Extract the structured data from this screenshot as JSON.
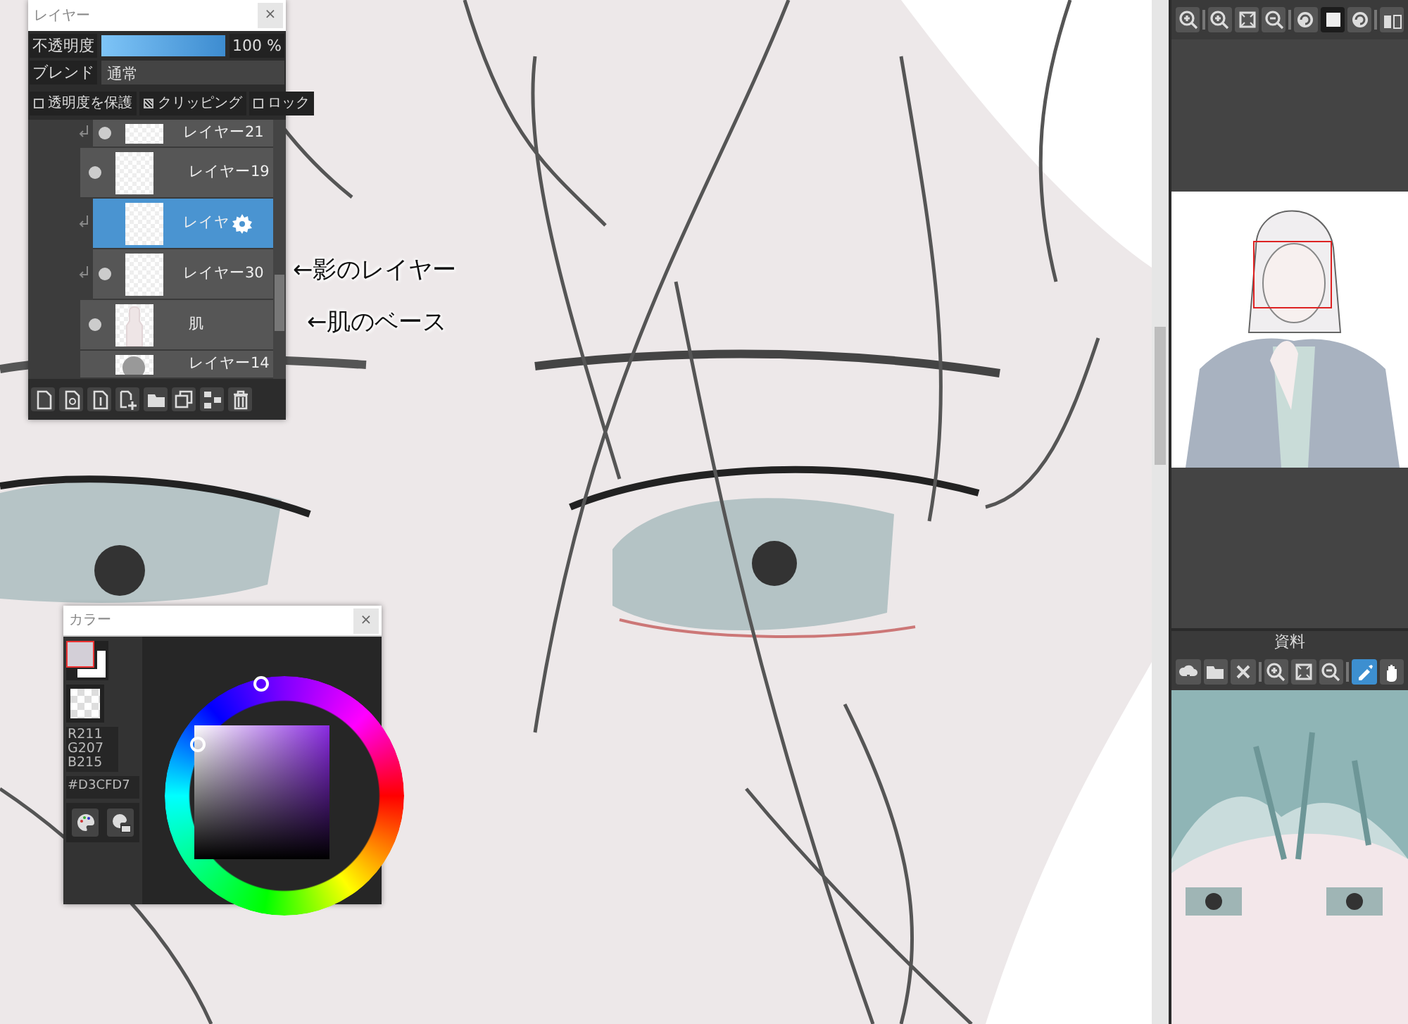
{
  "layer_panel": {
    "title": "レイヤー",
    "close": "×",
    "opacity": {
      "label": "不透明度",
      "level": 1,
      "reading": "100 %"
    },
    "blend": {
      "label": "ブレンド",
      "value": "通常"
    },
    "options": [
      {
        "label": "透明度を保護",
        "checked": false
      },
      {
        "label": "クリッピング",
        "checked": true
      },
      {
        "label": "ロック",
        "checked": false
      }
    ],
    "layers": [
      {
        "name": "レイヤー21",
        "visible": true,
        "clipped": true,
        "selected": false,
        "kind": "blank"
      },
      {
        "name": "レイヤー19",
        "visible": true,
        "clipped": false,
        "selected": false,
        "kind": "blank"
      },
      {
        "name": "レイヤ",
        "visible": false,
        "clipped": true,
        "selected": true,
        "kind": "blank"
      },
      {
        "name": "レイヤー30",
        "visible": true,
        "clipped": true,
        "selected": false,
        "kind": "blank"
      },
      {
        "name": "肌",
        "visible": true,
        "clipped": false,
        "selected": false,
        "kind": "silhouette"
      },
      {
        "name": "レイヤー14",
        "visible": false,
        "clipped": false,
        "selected": false,
        "kind": "round"
      }
    ]
  },
  "annotations": [
    "←影のレイヤー",
    "←肌のベース"
  ],
  "color_panel": {
    "title": "カラー",
    "close": "×",
    "foreground": {
      "color": "#d3cfd7"
    },
    "rgb": [
      "R211",
      "G207",
      "B215"
    ],
    "hex": "#D3CFD7"
  },
  "navigator_toolbar": [
    {
      "selected": false
    },
    {
      "selected": false
    },
    {
      "selected": false
    },
    {
      "selected": false
    },
    {
      "selected": false
    },
    {
      "selected": true
    },
    {
      "selected": false
    },
    {
      "selected": false
    }
  ],
  "resource_panel": {
    "title": "資料",
    "tools": [
      {
        "selected": false
      },
      {
        "selected": false
      },
      {
        "selected": false
      },
      {
        "selected": false
      },
      {
        "selected": false
      },
      {
        "selected": false
      },
      {
        "selected": true
      },
      {
        "selected": false
      }
    ]
  }
}
